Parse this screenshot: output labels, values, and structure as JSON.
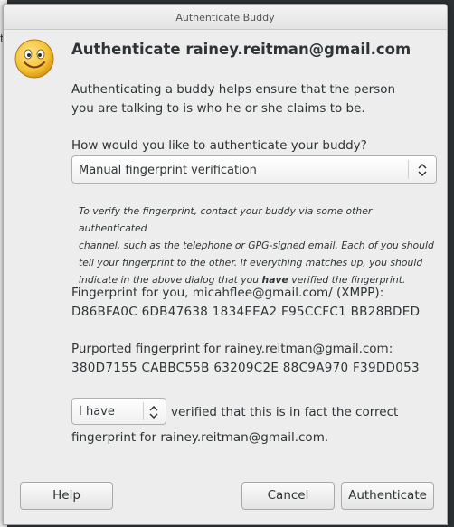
{
  "background": {
    "left_fragment": "t"
  },
  "window": {
    "title": "Authenticate Buddy"
  },
  "icon": {
    "name": "smiley-face-icon"
  },
  "heading": "Authenticate rainey.reitman@gmail.com",
  "intro": "Authenticating a buddy helps ensure that the person you are talking to is who he or she claims to be.",
  "question": "How would you like to authenticate your buddy?",
  "method_select": {
    "value": "Manual fingerprint verification"
  },
  "instructions": {
    "line1": "To verify the fingerprint, contact your buddy via some other authenticated",
    "line2": "channel, such as the telephone or GPG-signed email.  Each of you should",
    "line3": "tell your fingerprint to the other. If everything matches up, you should",
    "line4_before": "indicate in the above dialog that you ",
    "line4_bold": "have",
    "line4_after": " verified the fingerprint."
  },
  "fingerprint_you": {
    "label": "Fingerprint for you, micahflee@gmail.com/ (XMPP):",
    "value": "D86BFA0C 6DB47638 1834EEA2 F95CCFC1 BB28BDED"
  },
  "fingerprint_buddy": {
    "label": "Purported fingerprint for rainey.reitman@gmail.com:",
    "value": "380D7155 CABBC55B 63209C2E 88C9A970 F39DD053"
  },
  "verify": {
    "select_value": "I have",
    "text1": "verified that this is in fact the correct",
    "text2": "fingerprint for rainey.reitman@gmail.com."
  },
  "buttons": {
    "help": "Help",
    "cancel": "Cancel",
    "authenticate": "Authenticate"
  },
  "colors": {
    "dialog_bg": "#ededed",
    "text": "#2e3436",
    "desktop": "#2e3436",
    "smiley": "#f5c234"
  }
}
